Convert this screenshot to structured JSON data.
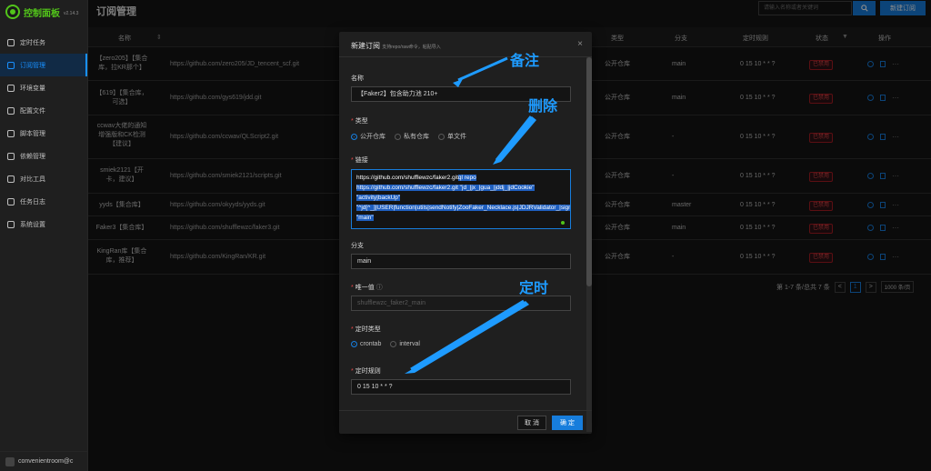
{
  "app": {
    "logo_text": "控制面板",
    "version": "v2.14.3"
  },
  "sidebar": {
    "items": [
      {
        "label": "定时任务"
      },
      {
        "label": "订阅管理",
        "active": true
      },
      {
        "label": "环境变量"
      },
      {
        "label": "配置文件"
      },
      {
        "label": "脚本管理"
      },
      {
        "label": "依赖管理"
      },
      {
        "label": "对比工具"
      },
      {
        "label": "任务日志"
      },
      {
        "label": "系统设置"
      }
    ],
    "user": "convenientroom@c"
  },
  "header": {
    "title": "订阅管理",
    "search_placeholder": "请输入名称或者关键词",
    "new_button": "新建订阅"
  },
  "table": {
    "columns": [
      "名称",
      "类型",
      "分支",
      "定时规则",
      "状态",
      "操作"
    ],
    "rows": [
      {
        "name": "【zero205】【集合库，拉KR那个】",
        "url": "https://github.com/zero205/JD_tencent_scf.git",
        "type": "公开仓库",
        "branch": "main",
        "cron": "0 15 10 * * ?",
        "status": "已禁用"
      },
      {
        "name": "【619】【集合库，可选】",
        "url": "https://github.com/gys619/jdd.git",
        "type": "公开仓库",
        "branch": "main",
        "cron": "0 15 10 * * ?",
        "status": "已禁用"
      },
      {
        "name": "ccwav大佬的通知增强版和CK检测【建议】",
        "url": "https://github.com/ccwav/QLScript2.git",
        "type": "公开仓库",
        "branch": "-",
        "cron": "0 15 10 * * ?",
        "status": "已禁用"
      },
      {
        "name": "smiek2121【开卡，建议】",
        "url": "https://github.com/smiek2121/scripts.git",
        "type": "公开仓库",
        "branch": "-",
        "cron": "0 15 10 * * ?",
        "status": "已禁用"
      },
      {
        "name": "yyds【集合库】",
        "url": "https://github.com/okyyds/yyds.git",
        "type": "公开仓库",
        "branch": "master",
        "cron": "0 15 10 * * ?",
        "status": "已禁用"
      },
      {
        "name": "Faker3【集合库】",
        "url": "https://github.com/shufflewzc/faker3.git",
        "type": "公开仓库",
        "branch": "main",
        "cron": "0 15 10 * * ?",
        "status": "已禁用"
      },
      {
        "name": "KingRan库【集合库，推荐】",
        "url": "https://github.com/KingRan/KR.git",
        "type": "公开仓库",
        "branch": "-",
        "cron": "0 15 10 * * ?",
        "status": "已禁用"
      }
    ]
  },
  "pagination": {
    "summary": "第 1-7 条/总共 7 条",
    "current": "1",
    "page_size": "1000 条/页",
    "prev": "<",
    "next": ">"
  },
  "modal": {
    "title": "新建订阅",
    "subtitle": "支持repo/raw命令，粘贴导入",
    "close": "×",
    "name_label": "名称",
    "name_value": "【Faker2】包含助力池 210+",
    "type_label": "类型",
    "type_options": [
      "公开仓库",
      "私有仓库",
      "单文件"
    ],
    "link_label": "链接",
    "link_text_plain": "https://github.com/shufflewzc/faker2.git",
    "link_text_selected": "ql repo https://github.com/shufflewzc/faker2.git \"jd_|jx_|gua_|jddj_|jdCookie\" \"activity|backUp\" \"^jd[^_]|USER|function|utils|sendNotify|ZooFaker_Necklace.js|JDJRValidator_|sign_graphics_validate|ql|JDSignValidator\" \"main\"",
    "branch_label": "分支",
    "branch_value": "main",
    "unique_label": "唯一值",
    "unique_value": "shufflewzc_faker2_main",
    "cron_type_label": "定时类型",
    "cron_type_options": [
      "crontab",
      "interval"
    ],
    "cron_label": "定时规则",
    "cron_value": "0 15 10 * * ?",
    "cancel": "取 消",
    "ok": "确 定"
  },
  "annotations": {
    "note": "备注",
    "delete": "删除",
    "timer": "定时",
    "color": "#1e9bff"
  }
}
